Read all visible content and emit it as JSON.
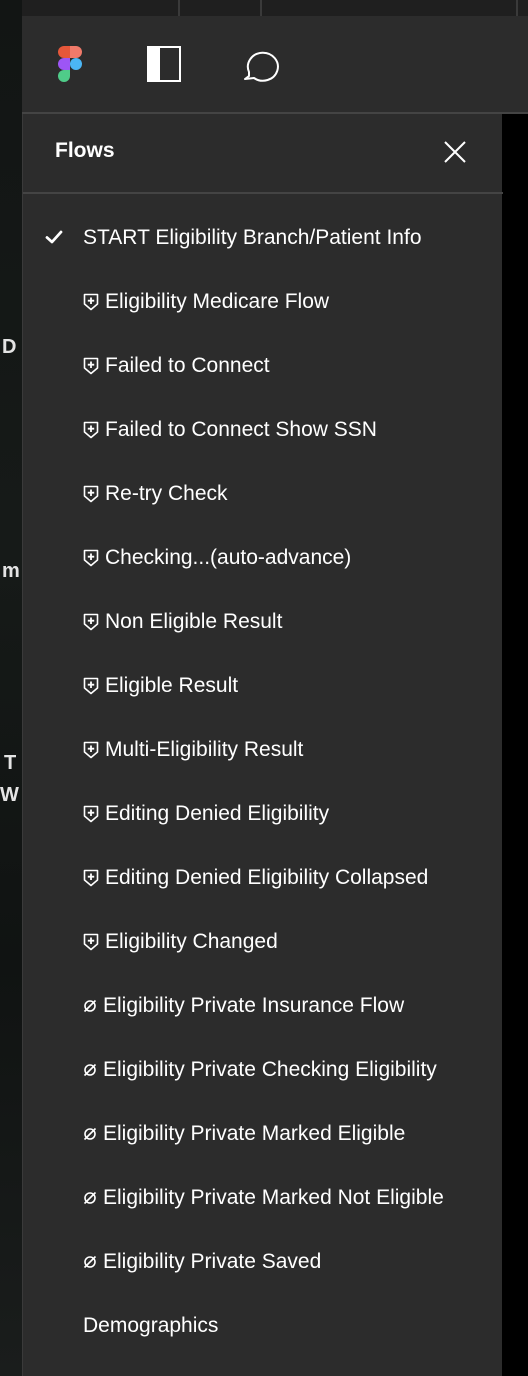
{
  "canvas_fragments": [
    "D",
    "m",
    "T",
    "W"
  ],
  "toolbar": {
    "icons": [
      "figma-logo-icon",
      "sidebar-toggle-icon",
      "comment-icon"
    ]
  },
  "panel": {
    "title": "Flows",
    "close_icon": "close-icon",
    "items": [
      {
        "label": "START Eligibility Branch/Patient Info",
        "icon": "none",
        "selected": true
      },
      {
        "label": "Eligibility Medicare Flow",
        "icon": "shield-plus-icon",
        "selected": false
      },
      {
        "label": "Failed to Connect",
        "icon": "shield-plus-icon",
        "selected": false
      },
      {
        "label": "Failed to Connect Show SSN",
        "icon": "shield-plus-icon",
        "selected": false
      },
      {
        "label": "Re-try Check",
        "icon": "shield-plus-icon",
        "selected": false
      },
      {
        "label": "Checking...(auto-advance)",
        "icon": "shield-plus-icon",
        "selected": false
      },
      {
        "label": "Non Eligible Result",
        "icon": "shield-plus-icon",
        "selected": false
      },
      {
        "label": "Eligible Result",
        "icon": "shield-plus-icon",
        "selected": false
      },
      {
        "label": "Multi-Eligibility Result",
        "icon": "shield-plus-icon",
        "selected": false
      },
      {
        "label": "Editing Denied Eligibility",
        "icon": "shield-plus-icon",
        "selected": false
      },
      {
        "label": "Editing Denied Eligibility Collapsed",
        "icon": "shield-plus-icon",
        "selected": false
      },
      {
        "label": "Eligibility Changed",
        "icon": "shield-plus-icon",
        "selected": false
      },
      {
        "label": "Eligibility Private Insurance Flow",
        "icon": "empty-set-icon",
        "selected": false
      },
      {
        "label": "Eligibility Private Checking Eligibility",
        "icon": "empty-set-icon",
        "selected": false
      },
      {
        "label": "Eligibility Private Marked Eligible",
        "icon": "empty-set-icon",
        "selected": false
      },
      {
        "label": "Eligibility Private Marked Not Eligible",
        "icon": "empty-set-icon",
        "selected": false
      },
      {
        "label": "Eligibility Private Saved",
        "icon": "empty-set-icon",
        "selected": false
      },
      {
        "label": "Demographics",
        "icon": "none",
        "selected": false
      }
    ]
  },
  "colors": {
    "panel_bg": "#2c2c2c",
    "text": "#ffffff",
    "divider": "#444444"
  }
}
